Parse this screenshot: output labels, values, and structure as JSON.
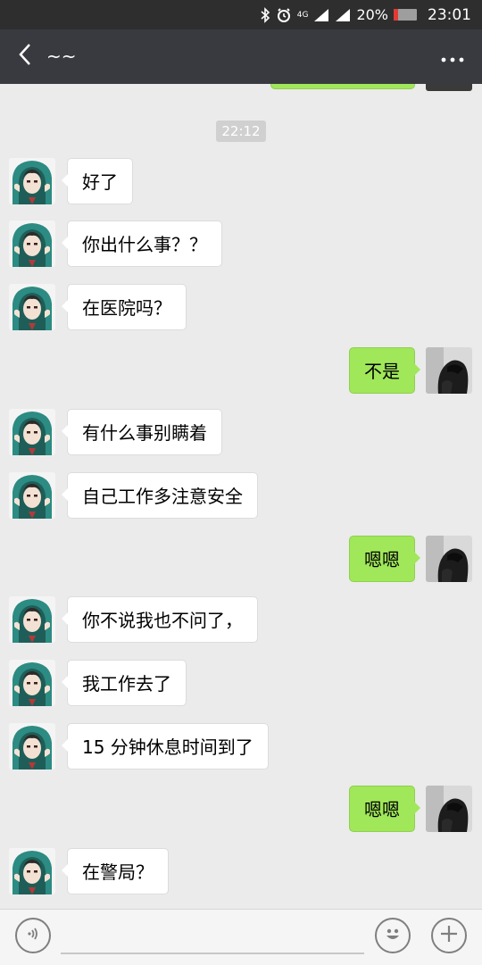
{
  "status_bar": {
    "network": "4G",
    "battery": "20%",
    "battery_level": 0.2,
    "time": "23:01"
  },
  "header": {
    "title": "~~"
  },
  "timestamp": "22:12",
  "messages": [
    {
      "side": "in",
      "text": "好了"
    },
    {
      "side": "in",
      "text": "你出什么事？？"
    },
    {
      "side": "in",
      "text": "在医院吗？"
    },
    {
      "side": "out",
      "text": "不是"
    },
    {
      "side": "in",
      "text": "有什么事别瞒着"
    },
    {
      "side": "in",
      "text": "自己工作多注意安全"
    },
    {
      "side": "out",
      "text": "嗯嗯"
    },
    {
      "side": "in",
      "text": "你不说我也不问了，"
    },
    {
      "side": "in",
      "text": "我工作去了"
    },
    {
      "side": "in",
      "text": "15 分钟休息时间到了"
    },
    {
      "side": "out",
      "text": "嗯嗯"
    },
    {
      "side": "in",
      "text": "在警局？"
    }
  ],
  "colors": {
    "incoming_bubble": "#ffffff",
    "outgoing_bubble": "#a0e75a",
    "title_bar": "#393a3f",
    "chat_background": "#ebebeb"
  },
  "icons": {
    "back": "chevron-left-icon",
    "more": "more-dots-icon",
    "voice": "voice-icon",
    "emoji": "emoji-icon",
    "plus": "plus-icon"
  }
}
